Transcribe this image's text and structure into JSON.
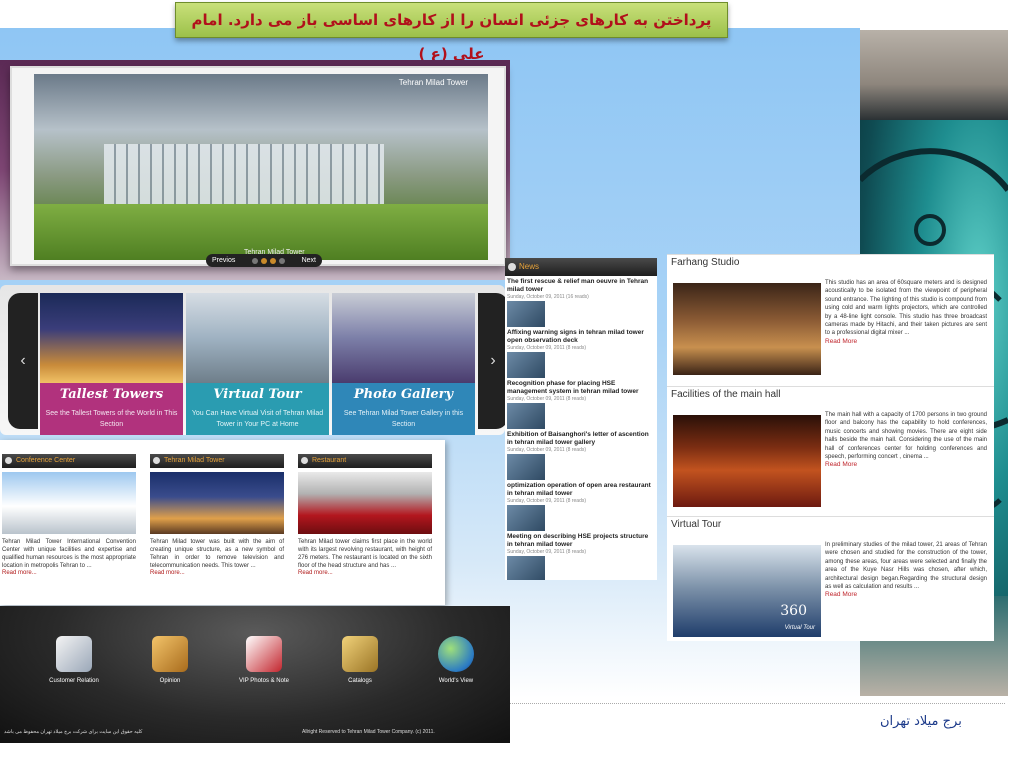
{
  "quote": {
    "text": "پرداختن به کارهای جزئی انسان را از کارهای اساسی باز می دارد.        امام علی (ع )"
  },
  "slider": {
    "caption_top": "Tehran Milad Tower",
    "caption_bottom": "Tehran Milad Tower",
    "nav": {
      "prev": "Previos",
      "next": "Next"
    }
  },
  "carousel": {
    "tiles": [
      {
        "title": "Tallest Towers",
        "desc": "See the Tallest Towers of the World in This Section",
        "color": "#b1327d"
      },
      {
        "title": "Virtual Tour",
        "desc": "You Can Have Virtual Visit of Tehran Milad Tower in Your PC at Home",
        "color": "#2a9cb1"
      },
      {
        "title": "Photo Gallery",
        "desc": "See Tehran Milad Tower Gallery in this Section",
        "color": "#2f87b8"
      }
    ]
  },
  "mid_boxes": [
    {
      "title": "Conference Center",
      "text": "Tehran Milad Tower International Convention Center with unique facilities and expertise and qualified human resources is the most appropriate location in metropolis Tehran to ...",
      "more": "Read more..."
    },
    {
      "title": "Tehran Milad Tower",
      "text": "Tehran Milad tower was built with the aim of creating unique structure, as a new symbol of Tehran in order to remove television and telecommunication needs. This tower ...",
      "more": "Read more..."
    },
    {
      "title": "Restaurant",
      "text": "Tehran Milad tower claims first place in the world with its largest revolving restaurant, with height of 276 meters. The restaurant is located on the sixth floor of the head structure and has ...",
      "more": "Read more..."
    }
  ],
  "icons": [
    {
      "label": "Customer Relation"
    },
    {
      "label": "Opinion"
    },
    {
      "label": "VIP Photos & Note"
    },
    {
      "label": "Catalogs"
    },
    {
      "label": "World's View"
    }
  ],
  "footer": {
    "left": "کلیه حقوق این سایت برای شرکت برج میلاد تهران محفوظ می باشد",
    "right": "Allright Reserved to Tehran Milad Tower Company. (c) 2011.",
    "title": "برج میلاد تهران"
  },
  "news": {
    "header": "News",
    "items": [
      {
        "title": "The first rescue & relief man oeuvre in Tehran milad tower",
        "date": "Sunday, October 09, 2011 (16 reads)"
      },
      {
        "title": "Affixing warning signs in tehran milad tower open observation deck",
        "date": "Sunday, October 09, 2011 (8 reads)"
      },
      {
        "title": "Recognition phase for placing HSE management system in tehran milad tower",
        "date": "Sunday, October 09, 2011 (8 reads)"
      },
      {
        "title": "Exhibition of Baisanghori's letter of ascention in tehran milad tower gallery",
        "date": "Sunday, October 09, 2011 (8 reads)"
      },
      {
        "title": "optimization operation of open area restaurant in tehran milad tower",
        "date": "Sunday, October 09, 2011 (8 reads)"
      },
      {
        "title": "Meeting on describing HSE projects structure in tehran milad tower",
        "date": "Sunday, October 09, 2011 (8 reads)"
      }
    ]
  },
  "features": [
    {
      "title": "Farhang Studio",
      "desc": "This studio has an area of 60square meters and is designed acoustically to be isolated from the viewpoint of peripheral sound entrance. The lighting of this studio is compound from using cold and warm lights projectors, which are controlled by a 48-line light console. This studio has three broadcast cameras made by Hitachi, and their taken pictures are sent to a professional digital mixer ...",
      "more": "Read More"
    },
    {
      "title": "Facilities of the main hall",
      "desc": "The main hall with a capacity of 1700 persons in two ground floor and balcony has the capability to hold conferences, music concerts and showing movies. There are eight side halls beside the main hall. Considering the use of the main hall of conferences center for holding conferences and speech, performing concert , cinema ...",
      "more": "Read More"
    },
    {
      "title": "Virtual Tour",
      "desc": "In preliminary studies of the milad tower, 21 areas of Tehran were chosen and studied for the construction of the tower, among these areas, four areas were selected and finally the area of the Kuye Nasr Hills was chosen, after which, architectural design began.Regarding the structural design as well as calculation and results ...",
      "more": "Read More",
      "badge": "360",
      "badge_sub": "Virtual Tour"
    }
  ]
}
